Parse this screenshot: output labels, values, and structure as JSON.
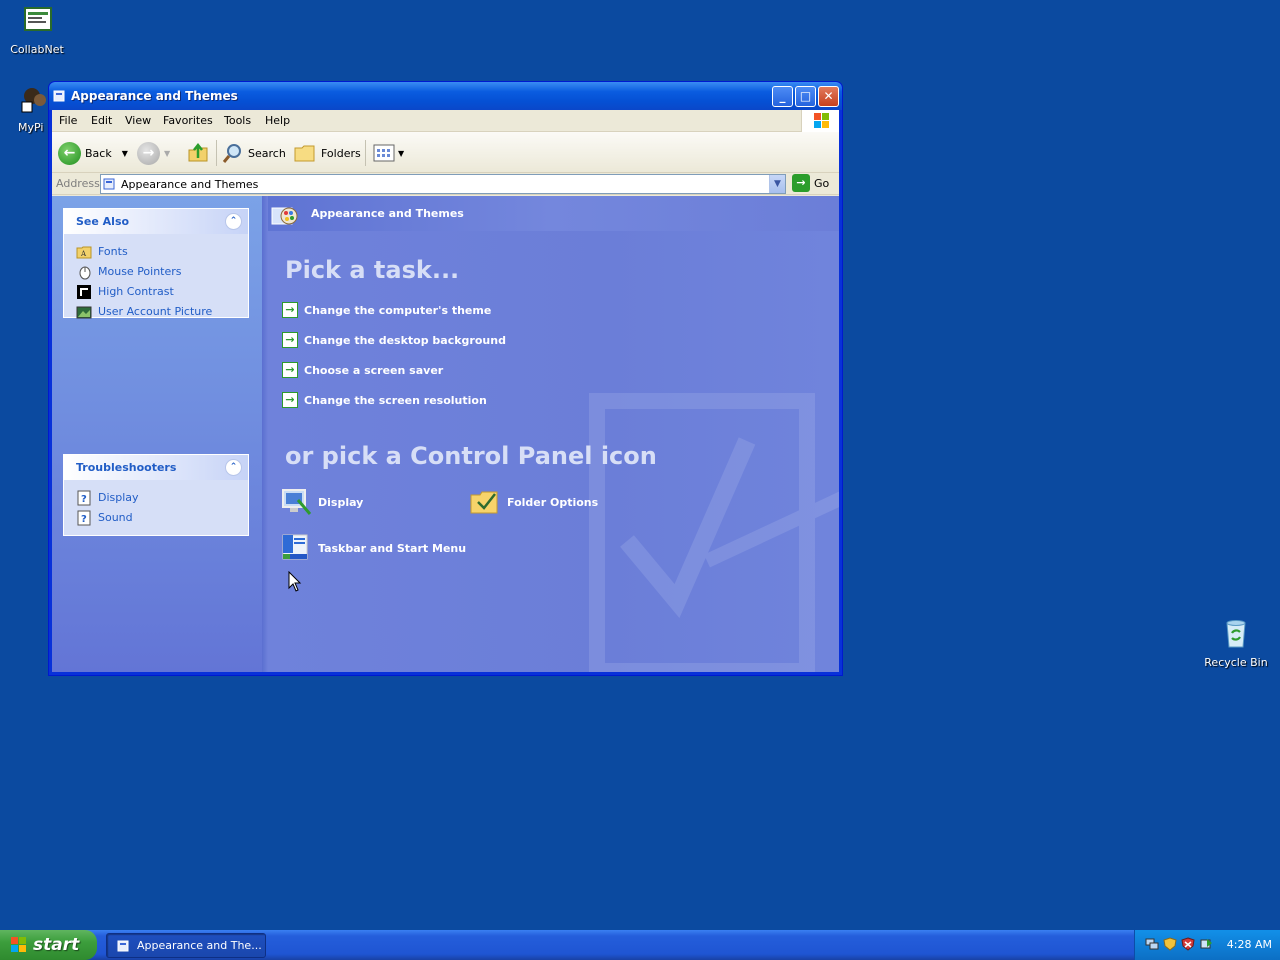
{
  "desktop": {
    "icons": [
      {
        "label": "CollabNet"
      },
      {
        "label": "MyPi"
      },
      {
        "label": "Recycle Bin"
      }
    ]
  },
  "window": {
    "title": "Appearance and Themes",
    "menu": [
      "File",
      "Edit",
      "View",
      "Favorites",
      "Tools",
      "Help"
    ],
    "toolbar": {
      "back_label": "Back",
      "search_label": "Search",
      "folders_label": "Folders"
    },
    "address": {
      "label": "Address",
      "value": "Appearance and Themes",
      "go_label": "Go"
    }
  },
  "sidepanel": {
    "see_also": {
      "title": "See Also",
      "items": [
        "Fonts",
        "Mouse Pointers",
        "High Contrast",
        "User Account Picture"
      ]
    },
    "troubleshooters": {
      "title": "Troubleshooters",
      "items": [
        "Display",
        "Sound"
      ]
    }
  },
  "main": {
    "header": "Appearance and Themes",
    "task_heading": "Pick a task...",
    "tasks": [
      "Change the computer's theme",
      "Change the desktop background",
      "Choose a screen saver",
      "Change the screen resolution"
    ],
    "icon_heading": "or pick a Control Panel icon",
    "icons": [
      "Display",
      "Folder Options",
      "Taskbar and Start Menu"
    ]
  },
  "taskbar": {
    "start_label": "start",
    "task_item": "Appearance and The...",
    "clock": "4:28 AM"
  },
  "colors": {
    "desktop": "#0b4aa0",
    "title_bar": "#0550d4",
    "link_blue": "#215dc6",
    "task_arrow": "#2d9a2d",
    "start_green": "#3c9e3c"
  }
}
